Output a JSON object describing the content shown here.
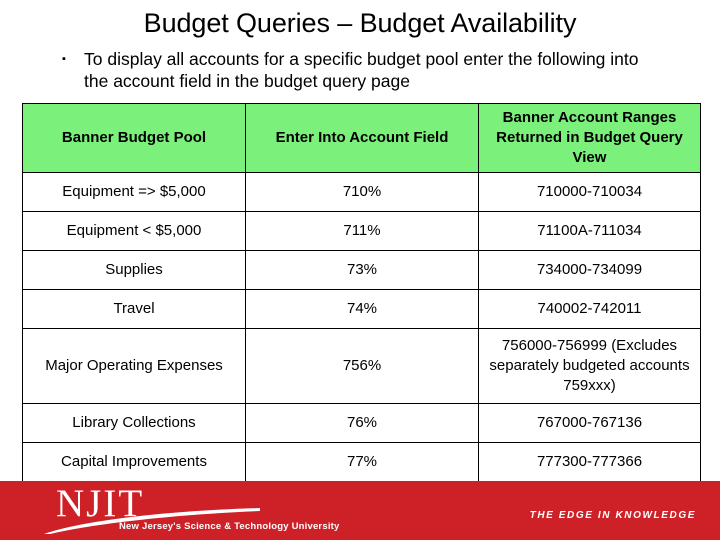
{
  "slide": {
    "title": "Budget Queries – Budget Availability",
    "bullet": {
      "marker": "square-bullet",
      "text": "To display all accounts for a specific budget pool enter the following into the account field in the budget query page"
    }
  },
  "table": {
    "header_bg": "#7BF07B",
    "columns": [
      "Banner Budget Pool",
      "Enter Into Account Field",
      "Banner Account Ranges Returned in Budget Query View"
    ],
    "rows": [
      {
        "pool": "Equipment => $5,000",
        "enter": "710%",
        "ranges": "710000-710034"
      },
      {
        "pool": "Equipment < $5,000",
        "enter": "711%",
        "ranges": "71100A-711034"
      },
      {
        "pool": "Supplies",
        "enter": "73%",
        "ranges": "734000-734099"
      },
      {
        "pool": "Travel",
        "enter": "74%",
        "ranges": "740002-742011"
      },
      {
        "pool": "Major Operating Expenses",
        "enter": "756%",
        "ranges": "756000-756999 (Excludes separately budgeted accounts 759xxx)"
      },
      {
        "pool": "Library Collections",
        "enter": "76%",
        "ranges": "767000-767136"
      },
      {
        "pool": "Capital Improvements",
        "enter": "77%",
        "ranges": "777300-777366"
      }
    ]
  },
  "footer": {
    "background": "#CE2027",
    "wordmark": "NJIT",
    "tagline": "New Jersey's Science & Technology University",
    "slogan": "THE EDGE IN KNOWLEDGE"
  }
}
